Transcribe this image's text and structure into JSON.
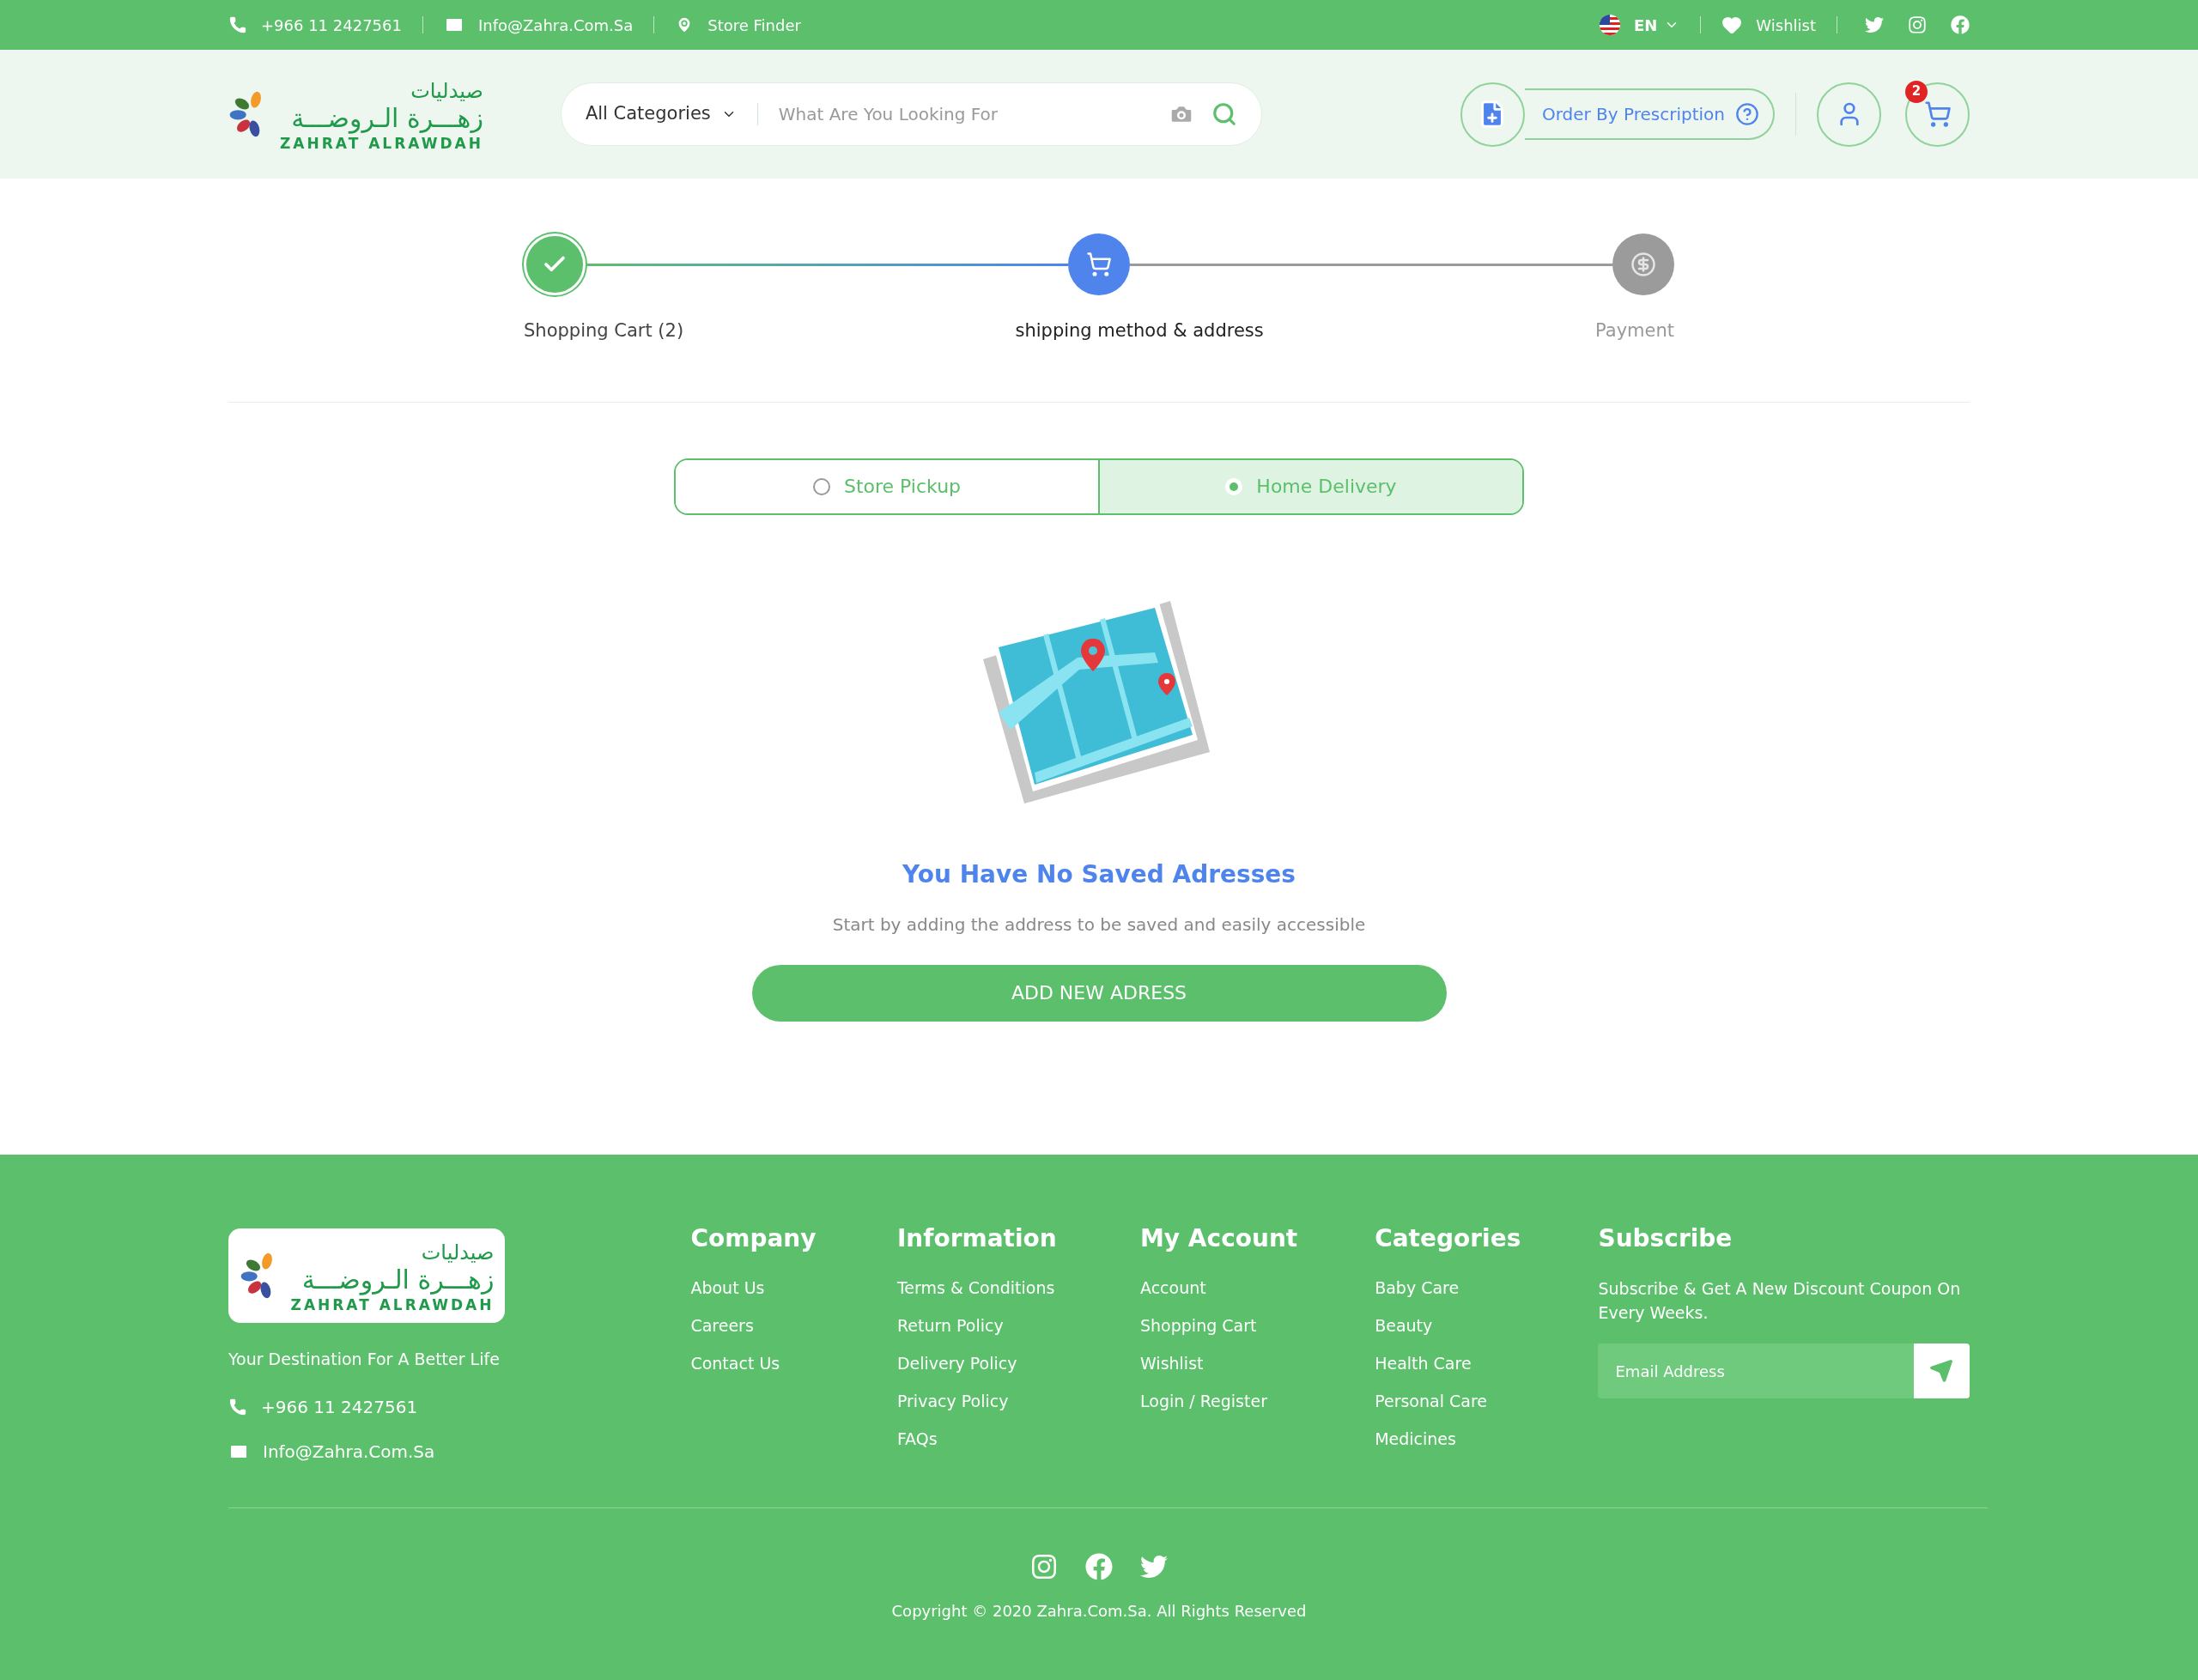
{
  "top_bar": {
    "phone": "+966 11 2427561",
    "email": "Info@Zahra.Com.Sa",
    "store_finder": "Store Finder",
    "language": "EN",
    "wishlist": "Wishlist"
  },
  "header": {
    "logo": {
      "arabic_top": "صيدليات",
      "arabic_name": "زهـــرة الـروضـــة",
      "latin_name": "ZAHRAT ALRAWDAH"
    },
    "search": {
      "category": "All Categories",
      "placeholder": "What Are You Looking For"
    },
    "prescription_button": "Order By Prescription",
    "cart_count": "2"
  },
  "stepper": [
    {
      "label": "Shopping Cart (2)",
      "kind": "done"
    },
    {
      "label": "shipping method & address",
      "kind": "current"
    },
    {
      "label": "Payment",
      "kind": "pending"
    }
  ],
  "delivery_options": [
    {
      "label": "Store Pickup",
      "selected": false
    },
    {
      "label": "Home Delivery",
      "selected": true
    }
  ],
  "empty_state": {
    "title": "You Have No Saved Adresses",
    "text": "Start by adding the address to be saved and easily accessible",
    "button": "ADD NEW ADRESS"
  },
  "footer": {
    "logo": {
      "arabic_top": "صيدليات",
      "arabic_name": "زهـــرة الـروضـــة",
      "latin_name": "ZAHRAT ALRAWDAH"
    },
    "tagline": "Your Destination For A Better Life",
    "phone": "+966 11 2427561",
    "email": "Info@Zahra.Com.Sa",
    "columns": [
      {
        "title": "Company",
        "links": [
          "About Us",
          "Careers",
          "Contact Us"
        ]
      },
      {
        "title": "Information",
        "links": [
          "Terms & Conditions",
          "Return Policy",
          "Delivery Policy",
          "Privacy Policy",
          "FAQs"
        ]
      },
      {
        "title": "My Account",
        "links": [
          "Account",
          "Shopping Cart",
          "Wishlist",
          "Login / Register"
        ]
      },
      {
        "title": "Categories",
        "links": [
          "Baby Care",
          "Beauty",
          "Health Care",
          "Personal Care",
          "Medicines"
        ]
      }
    ],
    "subscribe": {
      "title": "Subscribe",
      "text": "Subscribe & Get A New Discount Coupon On Every Weeks.",
      "placeholder": "Email Address"
    },
    "copyright": "Copyright © 2020 Zahra.Com.Sa. All Rights Reserved"
  }
}
